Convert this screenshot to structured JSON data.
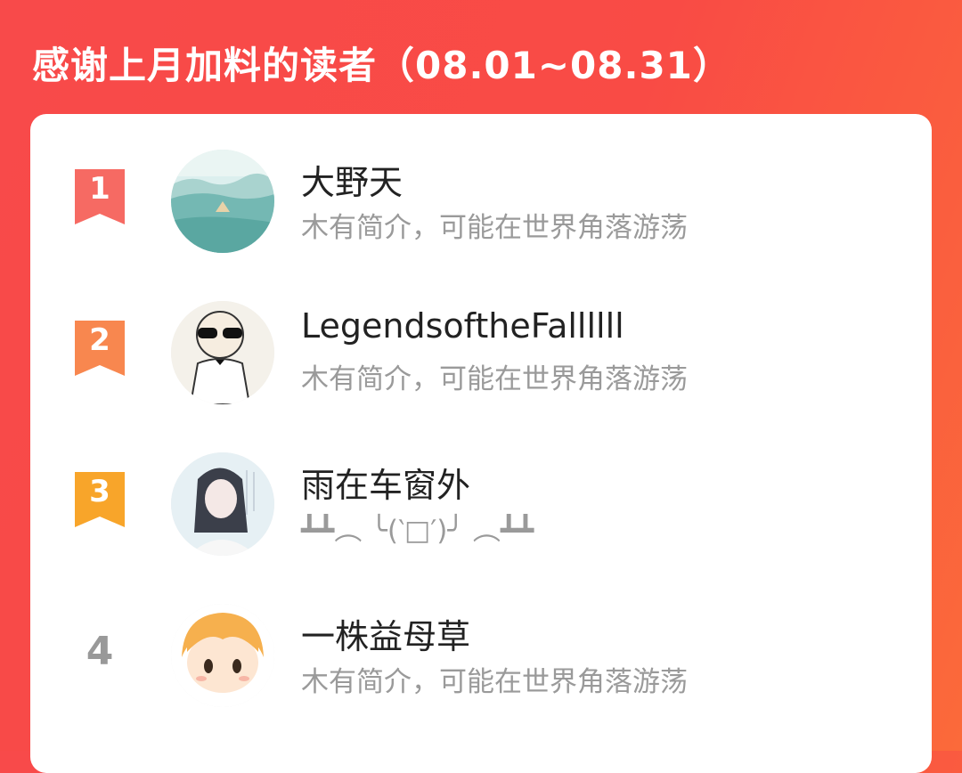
{
  "header": {
    "title": "感谢上月加料的读者（08.01~08.31）"
  },
  "readers": [
    {
      "rank": "1",
      "name": "大野天",
      "intro": "木有简介，可能在世界角落游荡",
      "badge_color": "#f66a63"
    },
    {
      "rank": "2",
      "name": "LegendsoftheFallllll",
      "intro": "木有简介，可能在世界角落游荡",
      "badge_color": "#f8874f"
    },
    {
      "rank": "3",
      "name": "雨在车窗外",
      "intro": "┻┻︵ ╰(‵□′)╯ ︵┻┻",
      "badge_color": "#f8a52a"
    },
    {
      "rank": "4",
      "name": "一株益母草",
      "intro": "木有简介，可能在世界角落游荡"
    }
  ],
  "colors": {
    "background_start": "#f84a4a",
    "background_end": "#fb6a3a",
    "card": "#ffffff"
  },
  "avatars": [
    "landscape-avatar",
    "sunglasses-character-avatar",
    "anime-girl-avatar",
    "orange-hair-chibi-avatar"
  ]
}
